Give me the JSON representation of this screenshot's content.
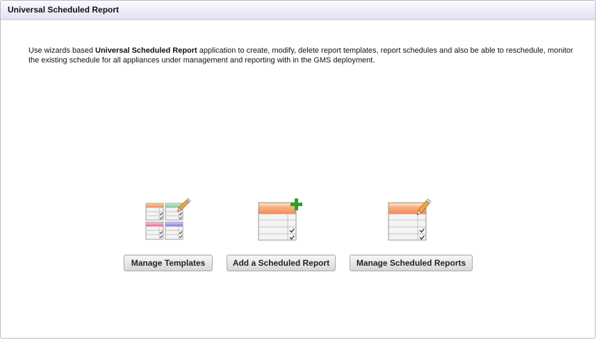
{
  "header": {
    "title": "Universal Scheduled Report"
  },
  "description": {
    "prefix": "Use wizards based ",
    "app_name": "Universal Scheduled Report",
    "suffix": " application to create, modify, delete report templates, report schedules and also be able to reschedule, monitor the existing schedule for all appliances under management and reporting with in the GMS deployment."
  },
  "actions": [
    {
      "label": "Manage Templates",
      "icon": "templates-grid-icon"
    },
    {
      "label": "Add a Scheduled Report",
      "icon": "add-report-icon"
    },
    {
      "label": "Manage Scheduled Reports",
      "icon": "edit-report-icon"
    }
  ],
  "colors": {
    "header_bg": "#e8e7f6",
    "orange": "#f6a26e",
    "green": "#8fd0a8",
    "pink": "#ee8ea6",
    "purple": "#9b92e6",
    "plus": "#2f9e26"
  }
}
